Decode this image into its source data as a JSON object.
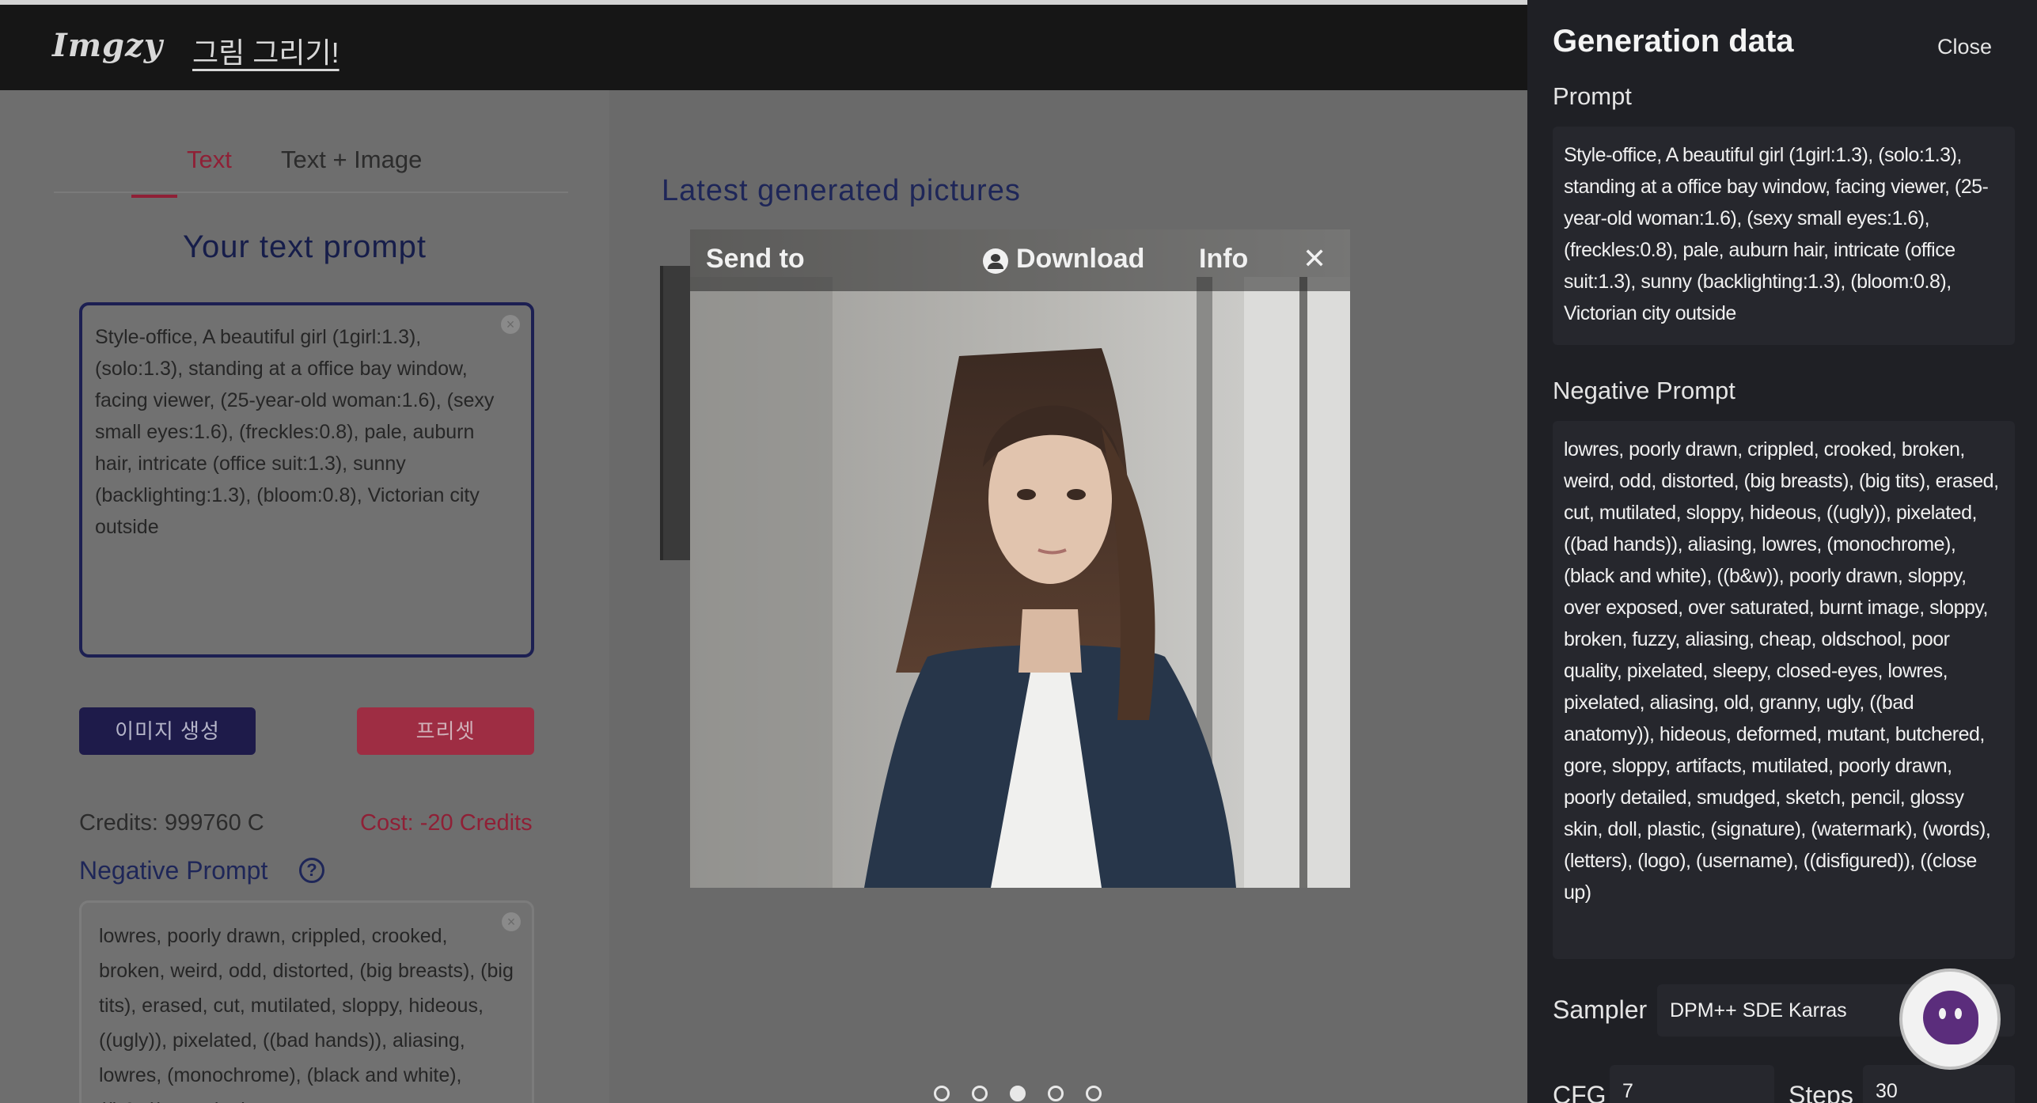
{
  "header": {
    "logo": "Imgzy",
    "nav_label": "그림 그리기!"
  },
  "left": {
    "tabs": [
      {
        "label": "Text",
        "active": true
      },
      {
        "label": "Text + Image",
        "active": false
      }
    ],
    "section_title": "Your text prompt",
    "prompt_value": "Style-office, A beautiful girl (1girl:1.3), (solo:1.3), standing at a office bay window, facing viewer, (25-year-old woman:1.6), (sexy small eyes:1.6), (freckles:0.8), pale, auburn hair, intricate (office suit:1.3), sunny (backlighting:1.3), (bloom:0.8), Victorian city outside",
    "generate_button": "이미지 생성",
    "preset_button": "프리셋",
    "credits": "Credits: 999760 C",
    "cost": "Cost: -20 Credits",
    "negative_label": "Negative Prompt",
    "help_icon": "?",
    "negative_value": "lowres, poorly drawn, crippled, crooked, broken, weird, odd, distorted, (big breasts), (big tits), erased, cut, mutilated, sloppy, hideous, ((ugly)), pixelated, ((bad hands)), aliasing, lowres, (monochrome), (black and white), ((b&w)), poorly drawn,"
  },
  "gallery": {
    "title": "Latest generated pictures",
    "toolbar": {
      "send_to": "Send to",
      "download": "Download",
      "info": "Info",
      "close": "✕"
    },
    "dots": [
      false,
      false,
      true,
      false,
      false
    ]
  },
  "generation_data": {
    "title": "Generation data",
    "close": "Close",
    "prompt_label": "Prompt",
    "prompt": "Style-office, A beautiful girl (1girl:1.3), (solo:1.3), standing at a office bay window, facing viewer, (25-year-old woman:1.6), (sexy small eyes:1.6), (freckles:0.8), pale, auburn hair, intricate (office suit:1.3), sunny (backlighting:1.3), (bloom:0.8), Victorian city outside",
    "negative_label": "Negative Prompt",
    "negative": "lowres, poorly drawn, crippled, crooked, broken, weird, odd, distorted, (big breasts), (big tits), erased, cut, mutilated, sloppy, hideous, ((ugly)), pixelated, ((bad hands)), aliasing, lowres, (monochrome), (black and white), ((b&w)), poorly drawn, sloppy, over exposed, over saturated, burnt image, sloppy, broken, fuzzy, aliasing, cheap, oldschool, poor quality, pixelated, sleepy, closed-eyes, lowres, pixelated, aliasing, old, granny, ugly, ((bad anatomy)), hideous, deformed, mutant, butchered, gore, sloppy, artifacts, mutilated, poorly drawn, poorly detailed, smudged, sketch, pencil, glossy skin, doll, plastic, (signature), (watermark), (words), (letters), (logo), (username), ((disfigured)), ((close up)",
    "sampler_label": "Sampler",
    "sampler": "DPM++ SDE Karras",
    "cfg_label": "CFG",
    "cfg": "7",
    "steps_label": "Steps",
    "steps": "30"
  },
  "colors": {
    "accent": "#8f2036",
    "navy": "#1e1b4a",
    "panel": "#1f2025"
  }
}
